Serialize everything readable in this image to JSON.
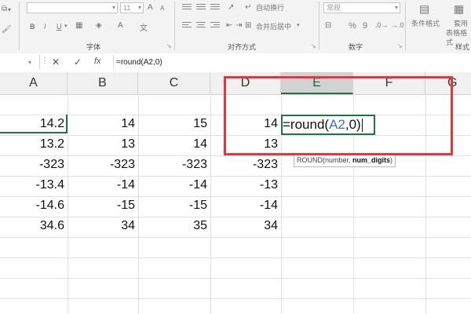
{
  "ribbon": {
    "font_name": "",
    "font_size": "11",
    "wrap_text": "自动换行",
    "merge_center": "合并后居中",
    "number_format": "常规",
    "cond_format": "条件格式",
    "table_format": "套用",
    "table_format2": "表格格式",
    "group_font": "字体",
    "group_align": "对齐方式",
    "group_number": "数字",
    "group_styles": "样式",
    "bold": "B",
    "italic": "I",
    "underline": "U",
    "percent": "%",
    "comma": "9",
    "grow_font": "A",
    "shrink_font": "A"
  },
  "formula_bar": {
    "cancel": "✕",
    "enter": "✓",
    "fx": "fx",
    "content": "=round(A2,0)"
  },
  "columns": [
    "A",
    "B",
    "C",
    "D",
    "E",
    "F",
    "G"
  ],
  "rows": [
    {
      "A": "",
      "B": "",
      "C": "",
      "D": ""
    },
    {
      "A": "14.2",
      "B": "14",
      "C": "15",
      "D": "14"
    },
    {
      "A": "13.2",
      "B": "13",
      "C": "14",
      "D": "13"
    },
    {
      "A": "-323",
      "B": "-323",
      "C": "-323",
      "D": "-323"
    },
    {
      "A": "-13.4",
      "B": "-14",
      "C": "-14",
      "D": "-13"
    },
    {
      "A": "-14.6",
      "B": "-15",
      "C": "-15",
      "D": "-14"
    },
    {
      "A": "34.6",
      "B": "34",
      "C": "35",
      "D": "34"
    }
  ],
  "editing": {
    "prefix": "=round(",
    "ref": "A2",
    "suffix": ",0)"
  },
  "tooltip": {
    "fn": "ROUND(number, ",
    "bold_arg": "num_digits",
    "end": ")"
  },
  "colors": {
    "excel_green": "#217346",
    "highlight_red": "#e5363d",
    "ref_blue": "#3a6fc4"
  }
}
